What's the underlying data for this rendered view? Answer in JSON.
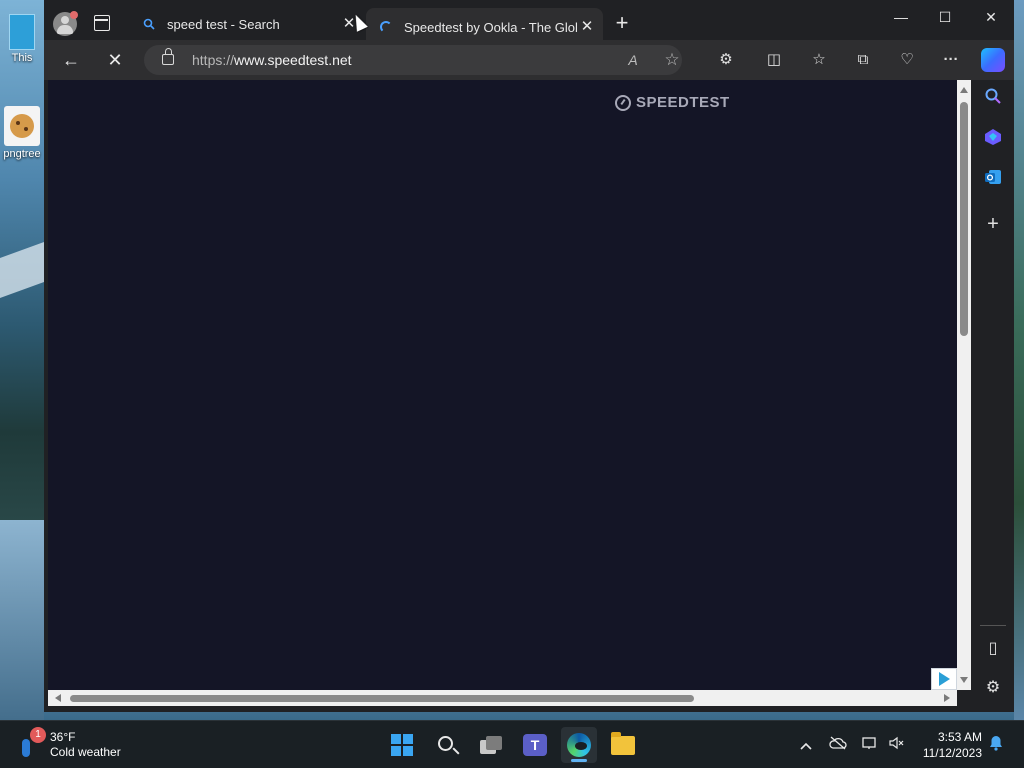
{
  "desktop": {
    "icons": [
      {
        "label": "This",
        "icon": "this-pc-icon"
      },
      {
        "label": "pngtree",
        "icon": "cookie-image-icon"
      }
    ]
  },
  "browser": {
    "tabs": [
      {
        "label": "speed test - Search",
        "icon": "search-icon",
        "active": false,
        "close": "✕"
      },
      {
        "label": "Speedtest by Ookla - The Global",
        "icon": "loading-spinner-icon",
        "active": true,
        "close": "✕"
      }
    ],
    "new_tab": "+",
    "window_controls": {
      "minimize": "—",
      "maximize": "☐",
      "close": "✕"
    },
    "toolbar": {
      "back": "←",
      "stop": "✕",
      "url_scheme": "https://",
      "url_host": "www.speedtest.net",
      "read_aloud": "A",
      "favorite": "☆",
      "extensions": "⚙",
      "split_screen": "◫",
      "favorites": "☆",
      "collections": "⧉",
      "browser_essentials": "♡",
      "more": "···"
    },
    "page": {
      "logo_text": "SPEEDTEST",
      "background": "#141526"
    },
    "sidebar": {
      "search": "🔍",
      "add": "+",
      "panel": "▯",
      "settings": "⚙"
    }
  },
  "taskbar": {
    "weather": {
      "temp": "36°F",
      "desc": "Cold weather",
      "badge": "1"
    },
    "apps": [
      "start",
      "search",
      "task-view",
      "teams",
      "edge",
      "file-explorer"
    ],
    "tray": {
      "chevron": "^"
    },
    "clock": {
      "time": "3:53 AM",
      "date": "11/12/2023"
    }
  }
}
